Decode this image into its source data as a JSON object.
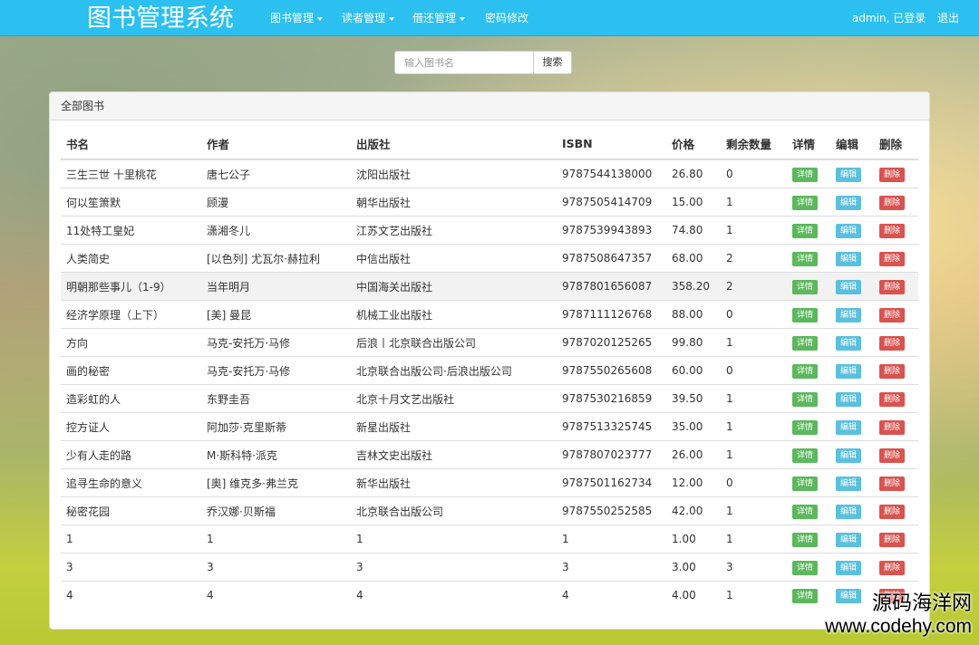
{
  "navbar": {
    "brand": "图书管理系统",
    "menu": [
      {
        "label": "图书管理",
        "dropdown": true
      },
      {
        "label": "读者管理",
        "dropdown": true
      },
      {
        "label": "借还管理",
        "dropdown": true
      },
      {
        "label": "密码修改",
        "dropdown": false
      }
    ],
    "user_status": "admin, 已登录",
    "logout": "退出"
  },
  "search": {
    "placeholder": "输入图书名",
    "button": "搜索"
  },
  "panel": {
    "title": "全部图书",
    "columns": [
      "书名",
      "作者",
      "出版社",
      "ISBN",
      "价格",
      "剩余数量",
      "详情",
      "编辑",
      "删除"
    ],
    "action_labels": {
      "detail": "详情",
      "edit": "编辑",
      "delete": "删除"
    },
    "rows": [
      {
        "title": "三生三世 十里桃花",
        "author": "唐七公子",
        "publisher": "沈阳出版社",
        "isbn": "9787544138000",
        "price": "26.80",
        "stock": "0"
      },
      {
        "title": "何以笙箫默",
        "author": "顾漫",
        "publisher": "朝华出版社",
        "isbn": "9787505414709",
        "price": "15.00",
        "stock": "1"
      },
      {
        "title": "11处特工皇妃",
        "author": "潇湘冬儿",
        "publisher": "江苏文艺出版社",
        "isbn": "9787539943893",
        "price": "74.80",
        "stock": "1"
      },
      {
        "title": "人类简史",
        "author": "[以色列] 尤瓦尔·赫拉利",
        "publisher": "中信出版社",
        "isbn": "9787508647357",
        "price": "68.00",
        "stock": "2"
      },
      {
        "title": "明朝那些事儿（1-9）",
        "author": "当年明月",
        "publisher": "中国海关出版社",
        "isbn": "9787801656087",
        "price": "358.20",
        "stock": "2"
      },
      {
        "title": "经济学原理（上下）",
        "author": "[美] 曼昆",
        "publisher": "机械工业出版社",
        "isbn": "9787111126768",
        "price": "88.00",
        "stock": "0"
      },
      {
        "title": "方向",
        "author": "马克-安托万·马修",
        "publisher": "后浪丨北京联合出版公司",
        "isbn": "9787020125265",
        "price": "99.80",
        "stock": "1"
      },
      {
        "title": "画的秘密",
        "author": "马克-安托万·马修",
        "publisher": "北京联合出版公司·后浪出版公司",
        "isbn": "9787550265608",
        "price": "60.00",
        "stock": "0"
      },
      {
        "title": "造彩虹的人",
        "author": "东野圭吾",
        "publisher": "北京十月文艺出版社",
        "isbn": "9787530216859",
        "price": "39.50",
        "stock": "1"
      },
      {
        "title": "控方证人",
        "author": "阿加莎·克里斯蒂",
        "publisher": "新星出版社",
        "isbn": "9787513325745",
        "price": "35.00",
        "stock": "1"
      },
      {
        "title": "少有人走的路",
        "author": "M·斯科特·派克",
        "publisher": "吉林文史出版社",
        "isbn": "9787807023777",
        "price": "26.00",
        "stock": "1"
      },
      {
        "title": "追寻生命的意义",
        "author": "[奥] 维克多·弗兰克",
        "publisher": "新华出版社",
        "isbn": "9787501162734",
        "price": "12.00",
        "stock": "0"
      },
      {
        "title": "秘密花园",
        "author": "乔汉娜·贝斯福",
        "publisher": "北京联合出版公司",
        "isbn": "9787550252585",
        "price": "42.00",
        "stock": "1"
      },
      {
        "title": "1",
        "author": "1",
        "publisher": "1",
        "isbn": "1",
        "price": "1.00",
        "stock": "1"
      },
      {
        "title": "3",
        "author": "3",
        "publisher": "3",
        "isbn": "3",
        "price": "3.00",
        "stock": "3"
      },
      {
        "title": "4",
        "author": "4",
        "publisher": "4",
        "isbn": "4",
        "price": "4.00",
        "stock": "1"
      }
    ],
    "highlighted_row": 4
  },
  "watermark": {
    "line1": "源码海洋网",
    "line2": "www.codehy.com"
  },
  "colors": {
    "navbar": "#2bc0ef",
    "detail_button": "#5cb85c",
    "edit_button": "#5bc0de",
    "delete_button": "#d9534f"
  }
}
